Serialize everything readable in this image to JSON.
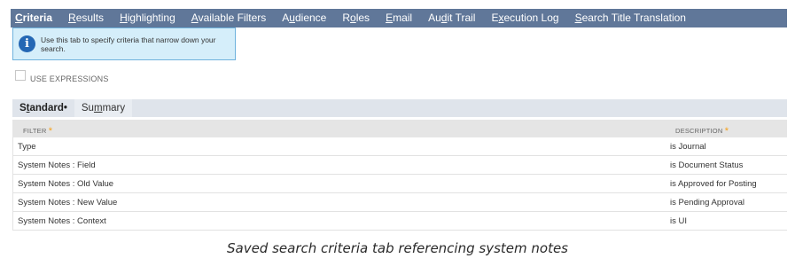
{
  "tabs": [
    {
      "pre": "",
      "u": "C",
      "post": "riteria",
      "active": true
    },
    {
      "pre": "",
      "u": "R",
      "post": "esults",
      "active": false
    },
    {
      "pre": "",
      "u": "H",
      "post": "ighlighting",
      "active": false
    },
    {
      "pre": "",
      "u": "A",
      "post": "vailable Filters",
      "active": false
    },
    {
      "pre": "A",
      "u": "u",
      "post": "dience",
      "active": false
    },
    {
      "pre": "R",
      "u": "o",
      "post": "les",
      "active": false
    },
    {
      "pre": "",
      "u": "E",
      "post": "mail",
      "active": false
    },
    {
      "pre": "Au",
      "u": "d",
      "post": "it Trail",
      "active": false
    },
    {
      "pre": "E",
      "u": "x",
      "post": "ecution Log",
      "active": false
    },
    {
      "pre": "",
      "u": "S",
      "post": "earch Title Translation",
      "active": false
    }
  ],
  "tooltip": {
    "icon_glyph": "i",
    "text": "Use this tab to specify criteria that narrow down your search."
  },
  "use_expressions": {
    "label": "USE EXPRESSIONS",
    "checked": false
  },
  "subtabs": [
    {
      "pre": "S",
      "u": "t",
      "post": "andard",
      "suffix": " •",
      "active": true
    },
    {
      "pre": "Su",
      "u": "m",
      "post": "mary",
      "suffix": "",
      "active": false
    }
  ],
  "columns": {
    "filter": "FILTER",
    "description": "DESCRIPTION",
    "required_mark": "*"
  },
  "rows": [
    {
      "filter": "Type",
      "description": "is Journal"
    },
    {
      "filter": "System Notes : Field",
      "description": "is Document Status"
    },
    {
      "filter": "System Notes : Old Value",
      "description": "is Approved for Posting"
    },
    {
      "filter": "System Notes : New Value",
      "description": "is Pending Approval"
    },
    {
      "filter": "System Notes : Context",
      "description": "is UI"
    }
  ],
  "caption": "Saved search criteria tab referencing system notes"
}
